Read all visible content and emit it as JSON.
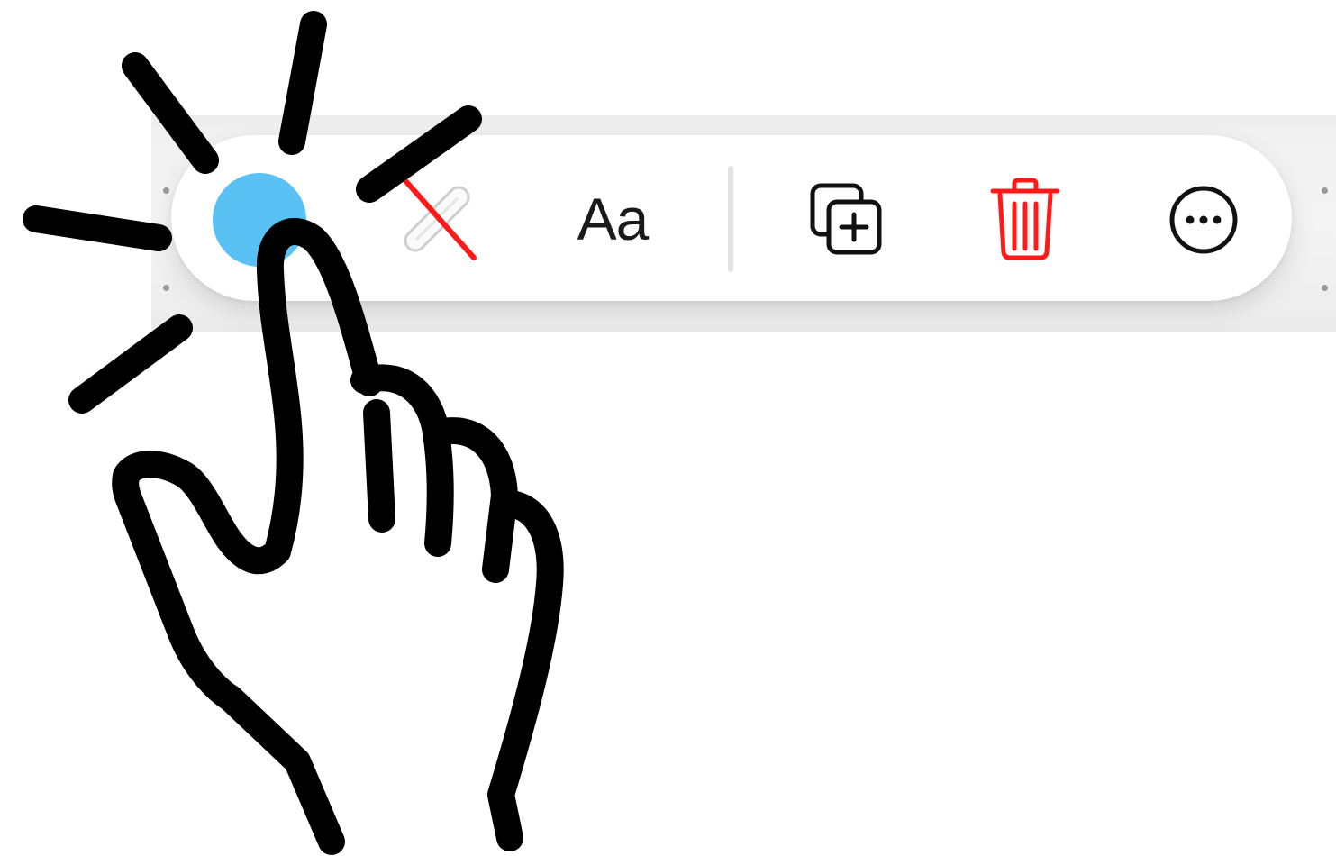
{
  "toolbar": {
    "color_swatch": "#5AC1F5",
    "text_style_label": "Aa",
    "icons": {
      "color": "color-swatch-icon",
      "pen": "pen-disabled-icon",
      "duplicate": "duplicate-plus-icon",
      "delete": "trash-icon",
      "more": "ellipsis-circle-icon"
    },
    "colors": {
      "delete": "#FF1A1A",
      "pen_strike": "#FF1A1A",
      "icon": "#111111"
    }
  },
  "overlay": {
    "gesture": "tap-hand-icon",
    "color": "#000000"
  }
}
